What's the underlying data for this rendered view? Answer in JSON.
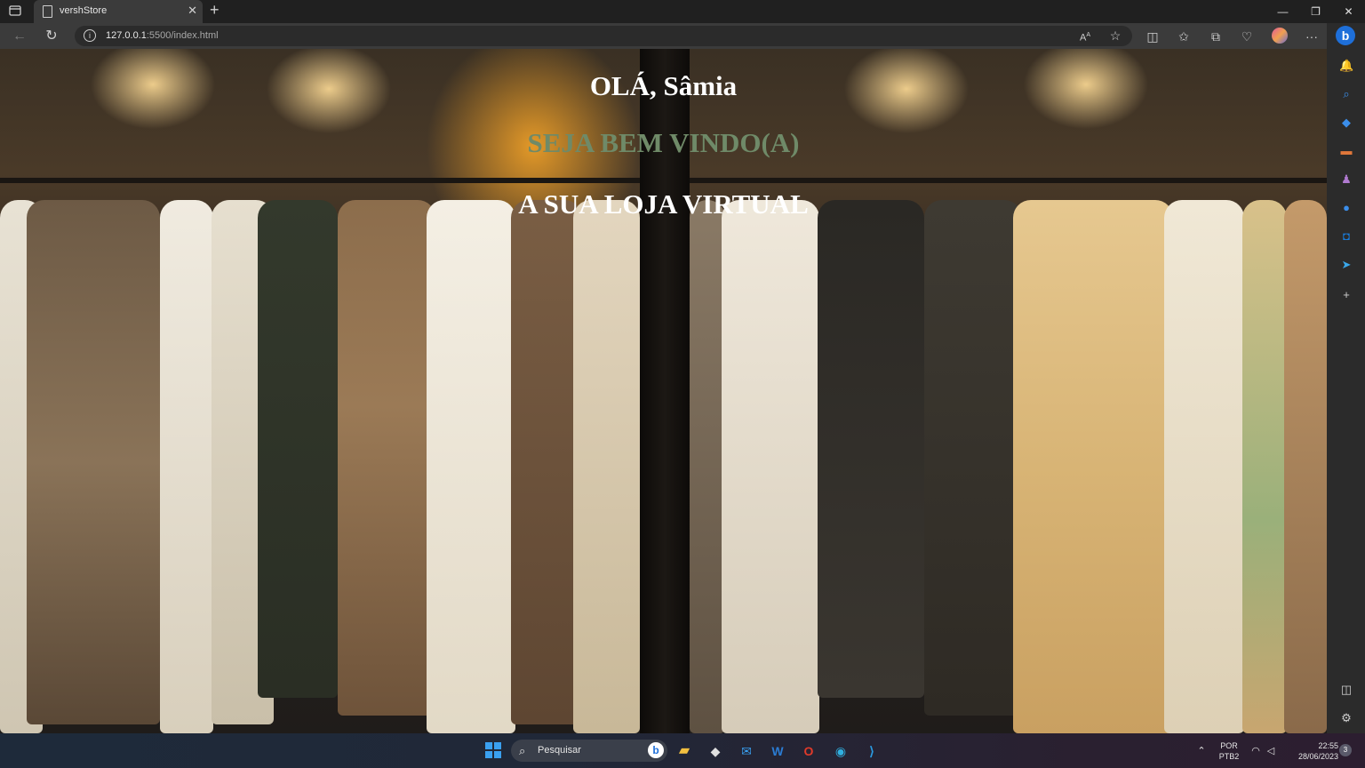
{
  "browser": {
    "tab_title": "vershStore",
    "url_host": "127.0.0.1",
    "url_rest": ":5500/index.html"
  },
  "hero": {
    "greeting": "OLÁ, Sâmia",
    "welcome": "SEJA BEM VINDO(A)",
    "tagline": "A SUA LOJA VIRTUAL"
  },
  "colors": {
    "welcome_text": "#6f8a68",
    "heading_text": "#ffffff"
  },
  "taskbar": {
    "search_placeholder": "Pesquisar",
    "language_top": "POR",
    "language_bottom": "PTB2",
    "time": "22:55",
    "date": "28/06/2023",
    "notification_count": "3"
  },
  "icons": {
    "sidebar": [
      "bell-icon",
      "search-icon",
      "tag-icon",
      "briefcase-icon",
      "games-icon",
      "edge-drop-icon",
      "outlook-icon",
      "send-icon",
      "plus-icon",
      "split-icon",
      "settings-icon"
    ]
  }
}
